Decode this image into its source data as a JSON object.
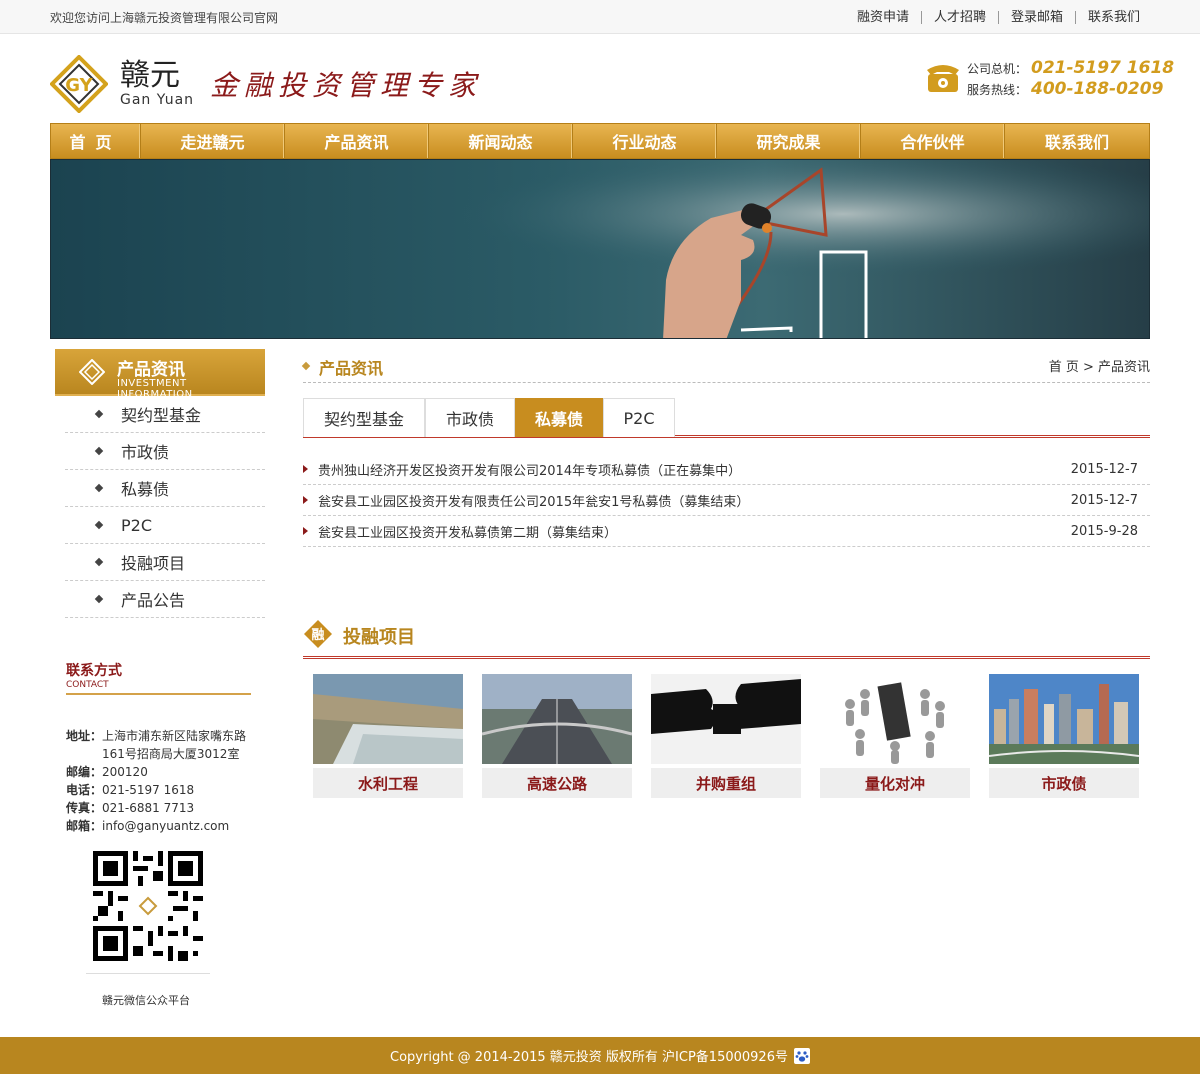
{
  "topbar": {
    "welcome": "欢迎您访问上海赣元投资管理有限公司官网",
    "links": [
      "融资申请",
      "人才招聘",
      "登录邮箱",
      "联系我们"
    ]
  },
  "header": {
    "logo_cn": "赣元",
    "logo_en": "Gan Yuan",
    "slogan": "金融投资管理专家",
    "hotline_label_1": "公司总机：",
    "hotline_value_1": "021-5197 1618",
    "hotline_label_2": "服务热线：",
    "hotline_value_2": "400-188-0209"
  },
  "nav": [
    "首页",
    "走进赣元",
    "产品资讯",
    "新闻动态",
    "行业动态",
    "研究成果",
    "合作伙伴",
    "联系我们"
  ],
  "sidebar": {
    "title": "产品资讯",
    "subtitle": "INVESTMENT INFORMATION",
    "items": [
      "契约型基金",
      "市政债",
      "私募债",
      "P2C",
      "投融项目",
      "产品公告"
    ],
    "contact_title": "联系方式",
    "contact_subtitle": "CONTACT",
    "address_label": "地址：",
    "address_line1": "上海市浦东新区陆家嘴东路",
    "address_line2": "161号招商局大厦3012室",
    "zip_label": "邮编：",
    "zip": "200120",
    "phone_label": "电话：",
    "phone": "021-5197 1618",
    "fax_label": "传真：",
    "fax": "021-6881 7713",
    "email_label": "邮箱：",
    "email": "info@ganyuantz.com",
    "qr_caption": "赣元微信公众平台"
  },
  "content": {
    "section_title": "产品资讯",
    "breadcrumb": "首 页 > 产品资讯",
    "tabs": [
      "契约型基金",
      "市政债",
      "私募债",
      "P2C"
    ],
    "active_tab": 2,
    "news": [
      {
        "title": "贵州独山经济开发区投资开发有限公司2014年专项私募债（正在募集中）",
        "date": "2015-12-7"
      },
      {
        "title": "瓮安县工业园区投资开发有限责任公司2015年瓮安1号私募债（募集结束）",
        "date": "2015-12-7"
      },
      {
        "title": "瓮安县工业园区投资开发私募债第二期（募集结束）",
        "date": "2015-9-28"
      }
    ],
    "projects_title": "投融项目",
    "projects_badge": "融",
    "projects": [
      "水利工程",
      "高速公路",
      "并购重组",
      "量化对冲",
      "市政债"
    ]
  },
  "footer": {
    "text": "Copyright @ 2014-2015 赣元投资 版权所有 沪ICP备15000926号"
  },
  "colors": {
    "brand_gold": "#c88d1f",
    "brand_red": "#8b1a1a",
    "hotline_gold": "#d29c1e",
    "footer_bg": "#b8861f"
  }
}
